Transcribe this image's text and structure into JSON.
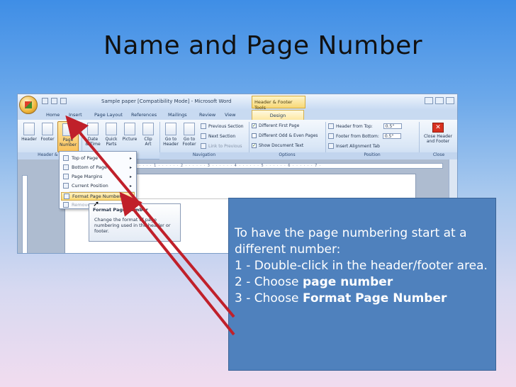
{
  "slide": {
    "title": "Name and Page Number"
  },
  "word": {
    "doc_title": "Sample paper [Compatibility Mode] - Microsoft Word",
    "contextual_tab": "Header & Footer Tools",
    "tabs": [
      "Home",
      "Insert",
      "Page Layout",
      "References",
      "Mailings",
      "Review",
      "View",
      "Design"
    ],
    "ribbon": {
      "header": "Header",
      "footer": "Footer",
      "page_number": "Page\nNumber",
      "date_time": "Date\n& Time",
      "quick_parts": "Quick\nParts",
      "picture": "Picture",
      "clip_art": "Clip\nArt",
      "go_to_header": "Go to\nHeader",
      "go_to_footer": "Go to\nFooter",
      "previous_section": "Previous Section",
      "next_section": "Next Section",
      "link_to_previous": "Link to Previous",
      "different_first_page": "Different First Page",
      "different_odd_even": "Different Odd & Even Pages",
      "show_document_text": "Show Document Text",
      "header_from_top": "Header from Top:",
      "header_from_top_value": "0.5\"",
      "footer_from_bottom": "Footer from Bottom:",
      "footer_from_bottom_value": "0.5\"",
      "insert_alignment_tab": "Insert Alignment Tab",
      "close_header_footer": "Close Header\nand Footer",
      "groups": {
        "header_footer": "Header & F",
        "navigation": "Navigation",
        "options": "Options",
        "position": "Position",
        "close": "Close"
      }
    },
    "menu": {
      "top_of_page": "Top of Page",
      "bottom_of_page": "Bottom of Page",
      "page_margins": "Page Margins",
      "current_position": "Current Position",
      "format_page_numbers": "Format Page Numbers...",
      "remove": "Remove"
    },
    "tooltip": {
      "title": "Format Page Number",
      "body": "Change the format of page numbering used in the header or footer."
    }
  },
  "callout": {
    "line1": "To have the page numbering start at a different number:",
    "step1": "1 - Double-click in the header/footer area.",
    "step2_prefix": "2 - Choose ",
    "step2_bold": "page number",
    "step3_prefix": "3 - Choose ",
    "step3_bold": "Format Page Number"
  },
  "colors": {
    "callout_fill": "#4f81bd",
    "arrow": "#c0202a",
    "highlight": "#fbd873"
  }
}
